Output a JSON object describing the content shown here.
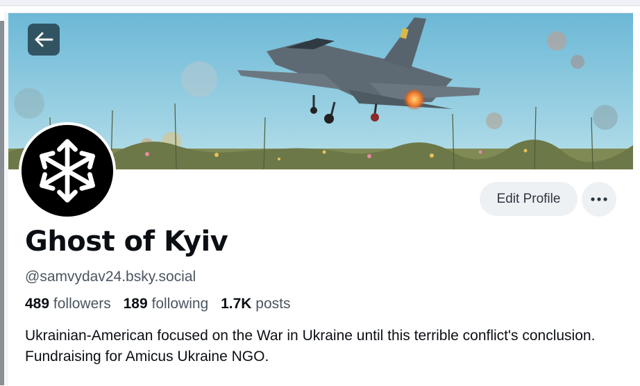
{
  "profile": {
    "display_name": "Ghost of Kyiv",
    "handle": "@samvydav24.bsky.social",
    "bio": "Ukrainian-American focused on the War in Ukraine until this terrible conflict's conclusion. Fundraising for Amicus Ukraine NGO.",
    "stats": {
      "followers_count": "489",
      "followers_label": "followers",
      "following_count": "189",
      "following_label": "following",
      "posts_count": "1.7K",
      "posts_label": "posts"
    }
  },
  "actions": {
    "edit_profile_label": "Edit Profile",
    "back_icon": "arrow-left-icon",
    "more_icon": "ellipsis-icon"
  },
  "banner": {
    "subject": "fighter-jet-takeoff-image"
  },
  "avatar": {
    "icon": "snowflake-arrows-logo"
  },
  "colors": {
    "banner_sky": "#7cc3dc",
    "button_bg": "#eef1f4",
    "text_primary": "#0b0f14",
    "text_secondary": "#4a5561"
  }
}
